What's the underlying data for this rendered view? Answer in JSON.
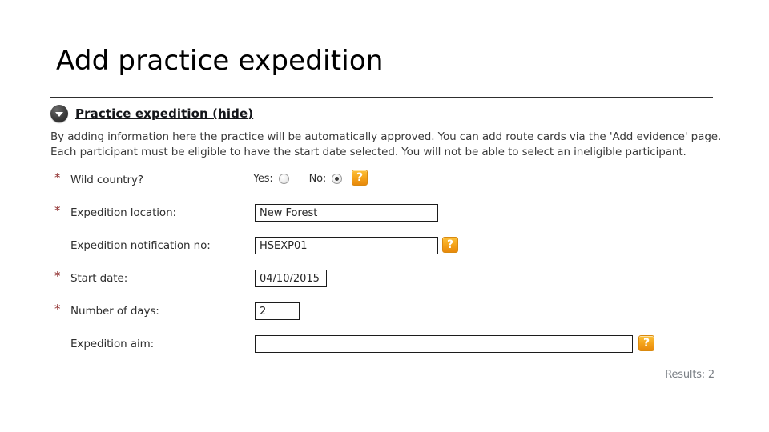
{
  "slide": {
    "title": "Add practice expedition"
  },
  "panel": {
    "icon": "collapse-triangle-icon",
    "title": "Practice expedition (hide)",
    "description_line1": "By adding information here the practice will be automatically approved. You can add route cards via the 'Add evidence' page.",
    "description_line2": "Each participant must be eligible to have the start date selected. You will not be able to select an ineligible participant."
  },
  "form": {
    "required_marker": "*",
    "rows": [
      {
        "label": "Wild country?",
        "required": true,
        "control": "radio",
        "yes_label": "Yes:",
        "no_label": "No:",
        "yes_checked": false,
        "no_checked": true,
        "help": "?"
      },
      {
        "label": "Expedition location:",
        "required": true,
        "control": "text",
        "value": "New Forest",
        "placeholder": ""
      },
      {
        "label": "Expedition notification no:",
        "required": false,
        "control": "text",
        "value": "HSEXP01",
        "placeholder": "",
        "help": "?"
      },
      {
        "label": "Start date:",
        "required": true,
        "control": "text",
        "value": "04/10/2015",
        "placeholder": ""
      },
      {
        "label": "Number of days:",
        "required": true,
        "control": "text",
        "value": "2",
        "placeholder": ""
      },
      {
        "label": "Expedition aim:",
        "required": false,
        "control": "text",
        "value": "",
        "placeholder": "",
        "help": "?"
      }
    ]
  },
  "footer": {
    "results": "Results: 2"
  },
  "colors": {
    "accent_orange": "#f5a51c",
    "required_star": "#8d2a2a",
    "rule": "#2e2e2e",
    "muted_text": "#7a7f85"
  }
}
